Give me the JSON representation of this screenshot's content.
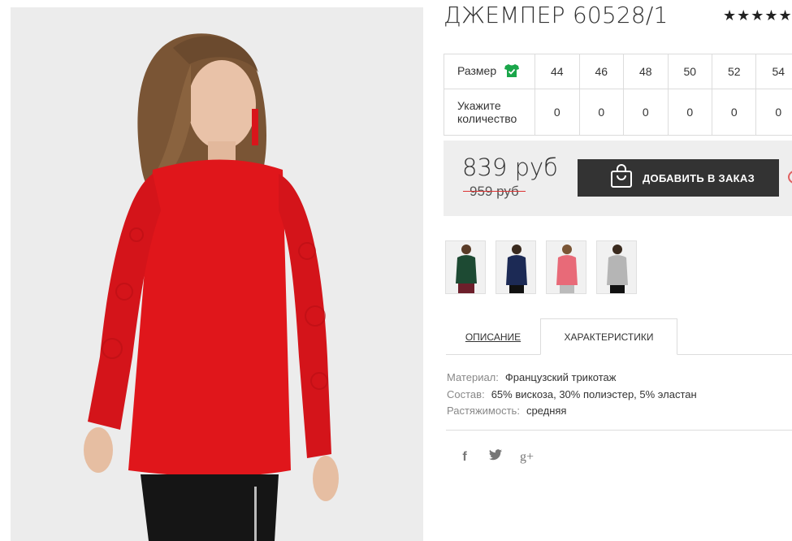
{
  "product": {
    "title": "ДЖЕМПЕР 60528/1",
    "rating_stars": "★★★★★"
  },
  "sizes": {
    "size_label": "Размер",
    "qty_label_1": "Укажите",
    "qty_label_2": "количество",
    "values": [
      "44",
      "46",
      "48",
      "50",
      "52",
      "54"
    ],
    "quantities": [
      "0",
      "0",
      "0",
      "0",
      "0",
      "0"
    ]
  },
  "price": {
    "current": "839 руб",
    "old": "959 руб",
    "order_button": "ДОБАВИТЬ В ЗАКАЗ"
  },
  "tabs": {
    "description": "ОПИСАНИЕ",
    "characteristics": "ХАРАКТЕРИСТИКИ"
  },
  "specs": [
    {
      "key": "Материал:",
      "value": "Французский трикотаж"
    },
    {
      "key": "Состав:",
      "value": "65% вискоза, 30% полиэстер, 5% эластан"
    },
    {
      "key": "Растяжимость:",
      "value": "средняя"
    }
  ],
  "colors": {
    "accent_dark": "#333333",
    "size_icon_green": "#1aa64a",
    "old_price_strike": "#dd3333",
    "product_red": "#e0161b"
  },
  "icons": {
    "size_guide": "tshirt-check-icon",
    "cart": "shopping-bag-icon",
    "wishlist": "heart-icon",
    "social": [
      "facebook-icon",
      "twitter-icon",
      "google-plus-icon"
    ]
  },
  "social": {
    "facebook": "f",
    "twitter": "t",
    "google": "g+"
  }
}
